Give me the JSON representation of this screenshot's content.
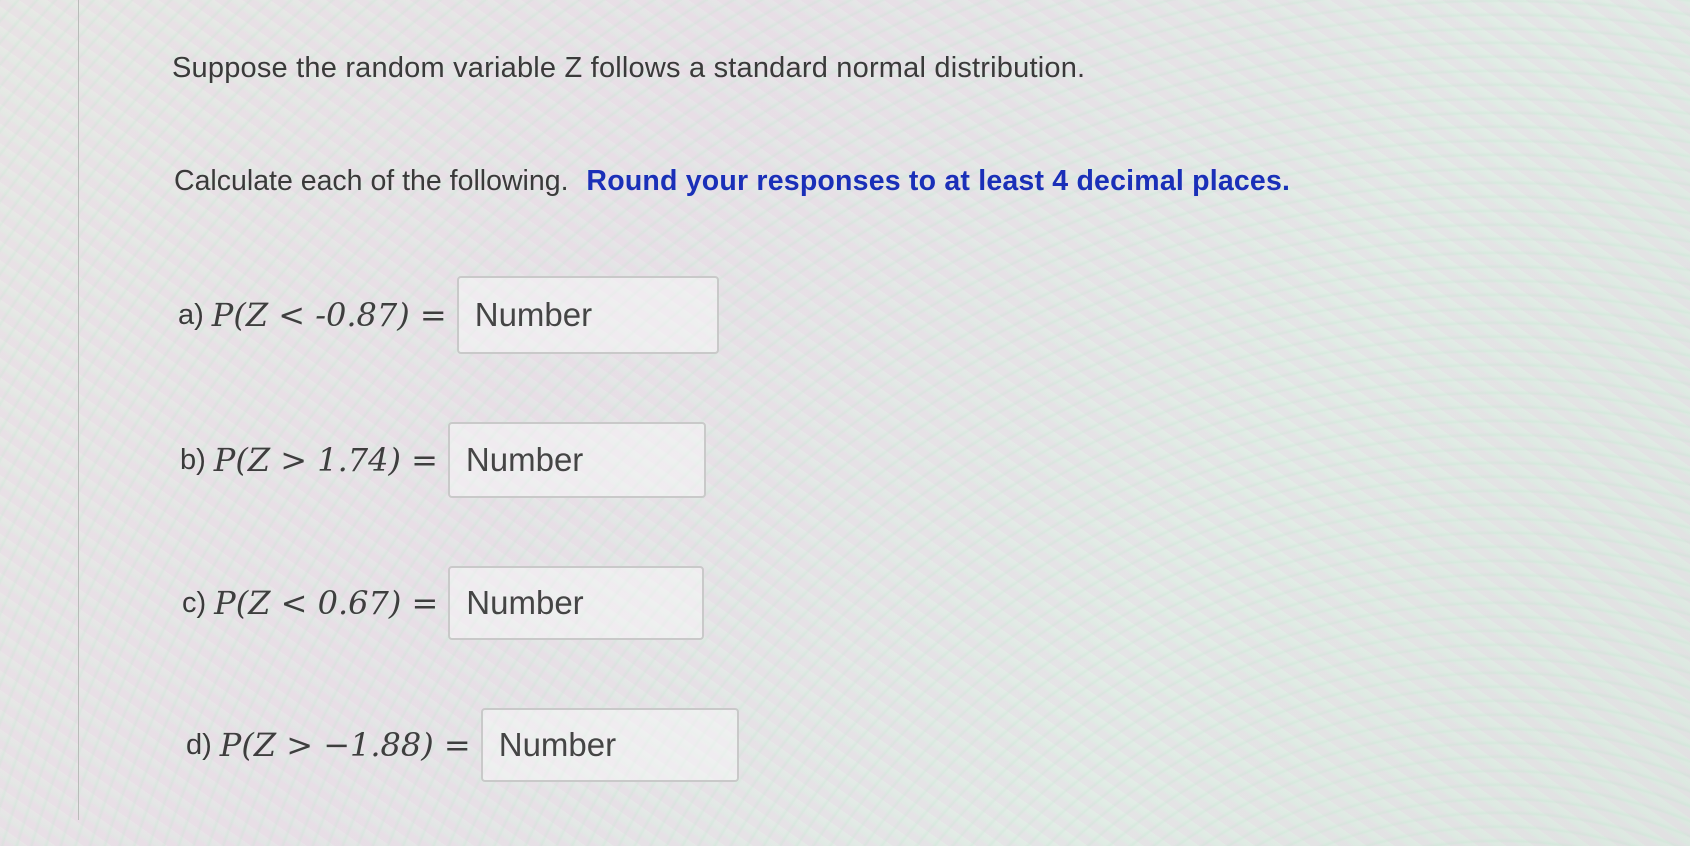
{
  "question": {
    "intro": "Suppose the random variable Z follows a standard normal distribution.",
    "instruction": "Calculate each of the following.",
    "instruction_emphasis": "Round your responses to at least 4 decimal places.",
    "emphasis_color": "#1a2fb8"
  },
  "parts": [
    {
      "label": "a)",
      "expression": "P(Z < -0.87) =",
      "placeholder": "Number",
      "value": ""
    },
    {
      "label": "b)",
      "expression": "P(Z > 1.74) =",
      "placeholder": "Number",
      "value": ""
    },
    {
      "label": "c)",
      "expression": "P(Z < 0.67) =",
      "placeholder": "Number",
      "value": ""
    },
    {
      "label": "d)",
      "expression": "P(Z > −1.88) =",
      "placeholder": "Number",
      "value": ""
    }
  ]
}
